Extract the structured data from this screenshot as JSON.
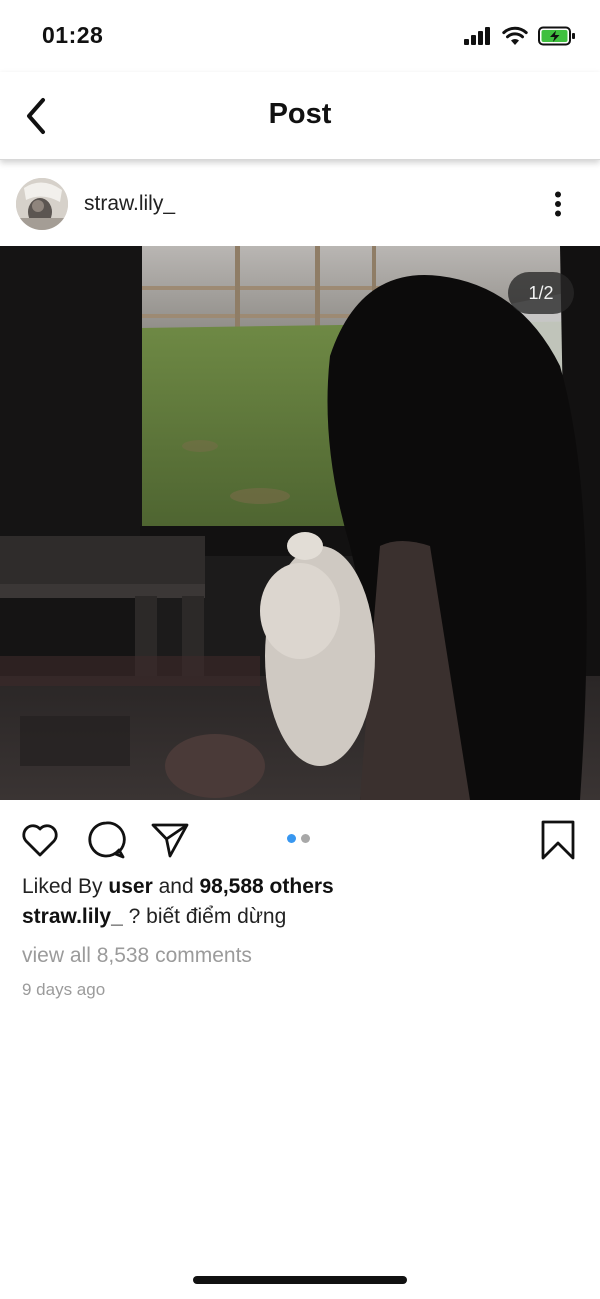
{
  "status_bar": {
    "time": "01:28",
    "icons": [
      "cellular-signal-icon",
      "wifi-icon",
      "battery-charging-icon"
    ],
    "battery_color": "#3fc03f"
  },
  "nav": {
    "title": "Post",
    "back_icon": "chevron-left-icon"
  },
  "post": {
    "username": "straw.lily_",
    "more_icon": "more-vertical-icon",
    "page_indicator": "1/2",
    "current_page": 1,
    "total_pages": 2,
    "likes": {
      "prefix": "Liked By",
      "user": "user",
      "and": "and",
      "others": "98,588 others"
    },
    "caption": {
      "username": "straw.lily_",
      "text": "? biết điểm dừng"
    },
    "view_comments": "view all 8,538 comments",
    "time_ago": "9 days ago"
  },
  "actions": {
    "like_icon": "heart-outline-icon",
    "comment_icon": "comment-bubble-icon",
    "share_icon": "send-paper-plane-icon",
    "save_icon": "bookmark-outline-icon"
  },
  "colors": {
    "active_dot": "#3897f0",
    "inactive_dot": "#a8a8a8"
  }
}
